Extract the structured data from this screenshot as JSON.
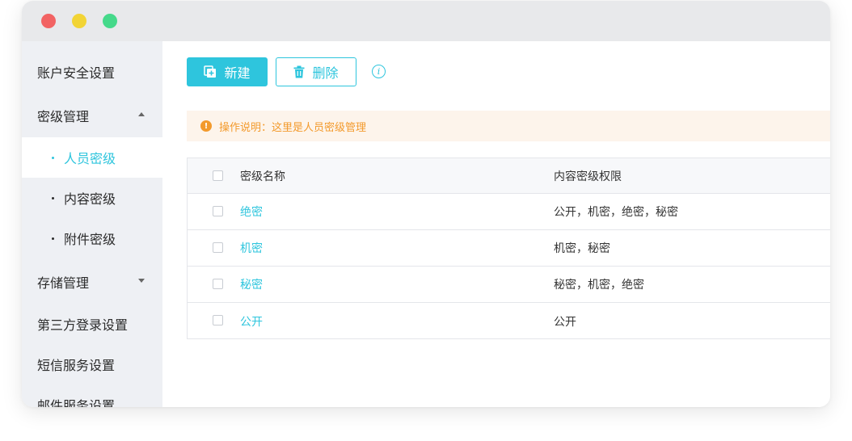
{
  "sidebar": {
    "items": [
      {
        "label": "账户安全设置"
      },
      {
        "label": "密级管理"
      },
      {
        "label": "存储管理"
      },
      {
        "label": "第三方登录设置"
      },
      {
        "label": "短信服务设置"
      },
      {
        "label": "邮件服务设置"
      }
    ],
    "sub_items": [
      {
        "label": "人员密级"
      },
      {
        "label": "内容密级"
      },
      {
        "label": "附件密级"
      }
    ]
  },
  "toolbar": {
    "new_label": "新建",
    "delete_label": "删除"
  },
  "notice": {
    "text": "操作说明：这里是人员密级管理"
  },
  "table": {
    "columns": [
      "密级名称",
      "内容密级权限"
    ],
    "rows": [
      {
        "name": "绝密",
        "perm": "公开，机密，绝密，秘密"
      },
      {
        "name": "机密",
        "perm": "机密，秘密"
      },
      {
        "name": "秘密",
        "perm": "秘密，机密，绝密"
      },
      {
        "name": "公开",
        "perm": "公开"
      }
    ]
  },
  "colors": {
    "accent": "#2ec5dd",
    "warning": "#f39a2c",
    "sidebar_bg": "#eef0f4"
  }
}
